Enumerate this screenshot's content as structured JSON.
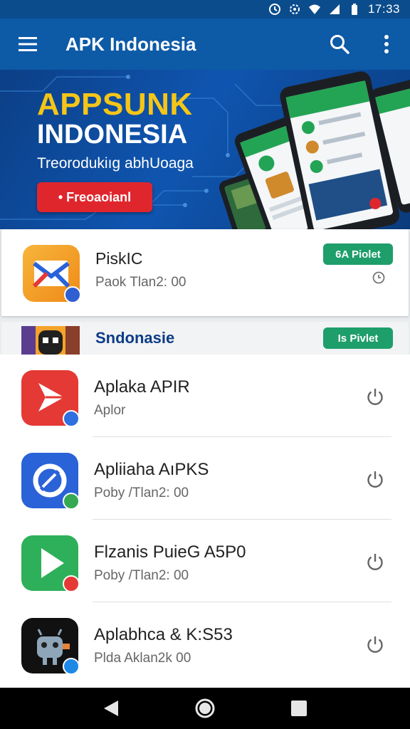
{
  "status_bar": {
    "time": "17:33"
  },
  "app_bar": {
    "title": "APK Indonesia"
  },
  "banner": {
    "headline_1": "APPSUNK",
    "headline_2": "INDONESIA",
    "subtitle": "Treorodukiıg abhUoaga",
    "cta_label": "• Freoaoianl"
  },
  "featured": {
    "name": "PiskIC",
    "meta": "Paok Tlan2: 00",
    "button_label": "6A Piolet"
  },
  "section": {
    "title": "Sndonasie",
    "button_label": "Is Pivlet"
  },
  "apps": [
    {
      "name": "Aplaka APIR",
      "meta": "Aplor",
      "icon": "red-play-icon",
      "color": "#e53935",
      "badge_color": "#2f6fe0"
    },
    {
      "name": "Apliiaha AıPKS",
      "meta": "Poby /Tlan2: 00",
      "icon": "blue-sync-icon",
      "color": "#2a62d8",
      "badge_color": "#34a853"
    },
    {
      "name": "Flzanis PuieG A5P0",
      "meta": "Poby /Tlan2: 00",
      "icon": "green-play-icon",
      "color": "#2eb05a",
      "badge_color": "#e53935"
    },
    {
      "name": "Aplabhca & K:S53",
      "meta": "Plda Aklan2k 00",
      "icon": "android-robot-icon",
      "color": "#111111",
      "badge_color": "#1e88e5"
    }
  ],
  "colors": {
    "app_bar": "#0d5aa7",
    "status_bar": "#0b4c8c",
    "accent_green": "#1e9e6a",
    "banner_yellow": "#f5c518",
    "banner_red": "#e0262d"
  }
}
